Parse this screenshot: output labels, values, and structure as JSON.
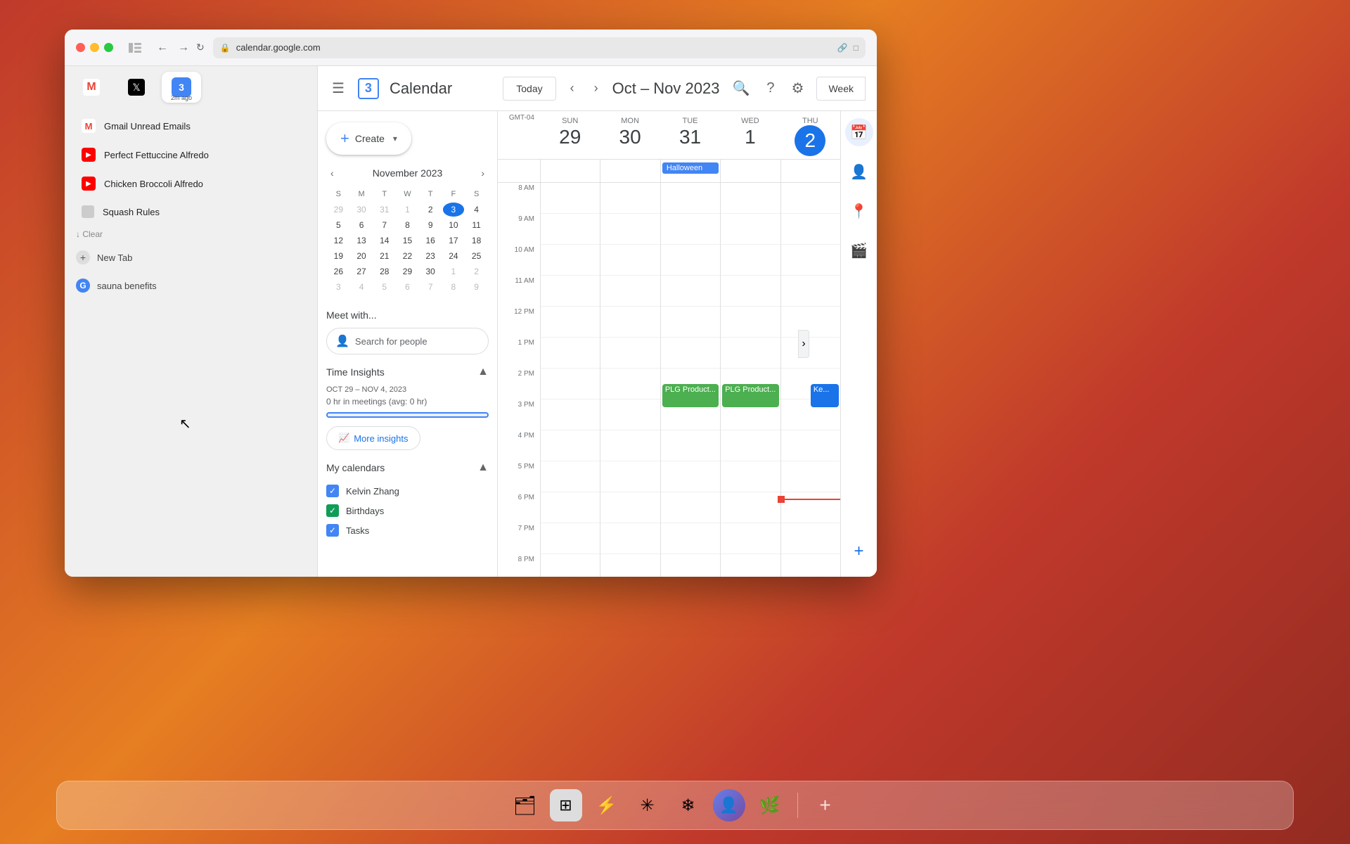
{
  "window": {
    "title": "Google Calendar",
    "url": "calendar.google.com"
  },
  "titlebar": {
    "back_label": "←",
    "forward_label": "→",
    "reload_label": "↻",
    "url": "calendar.google.com"
  },
  "tabs": [
    {
      "id": "gmail",
      "icon": "M",
      "color": "#EA4335",
      "bg": "#fff",
      "label": "Gmail"
    },
    {
      "id": "twitter",
      "icon": "𝕏",
      "color": "#000",
      "bg": "#fff",
      "label": "X"
    },
    {
      "id": "calendar",
      "icon": "3",
      "color": "#4285f4",
      "bg": "#fff",
      "label": "Google Calendar",
      "badge": "2m ago",
      "active": true
    }
  ],
  "recent_tabs": [
    {
      "id": "gmail-unread",
      "icon": "M",
      "icon_color": "#EA4335",
      "label": "Gmail Unread Emails",
      "sublabel": ""
    },
    {
      "id": "perfect-fettuccine",
      "icon": "▶",
      "icon_color": "#FF0000",
      "label": "Perfect Fettuccine Alfredo",
      "sublabel": ""
    },
    {
      "id": "chicken-broccoli",
      "icon": "▶",
      "icon_color": "#FF0000",
      "label": "Chicken Broccoli Alfredo",
      "sublabel": ""
    },
    {
      "id": "squash-rules",
      "icon": "□",
      "icon_color": "#888",
      "label": "Squash Rules",
      "sublabel": ""
    }
  ],
  "sidebar_actions": {
    "clear_label": "↓ Clear",
    "new_tab_label": "New Tab",
    "search_label": "sauna benefits"
  },
  "calendar": {
    "title": "Calendar",
    "header": {
      "today_label": "Today",
      "date_range": "Oct – Nov 2023",
      "view_label": "Week",
      "menu_icon": "☰",
      "search_icon": "🔍",
      "help_icon": "?",
      "settings_icon": "⚙"
    },
    "mini_cal": {
      "title": "November 2023",
      "days_of_week": [
        "S",
        "M",
        "T",
        "W",
        "T",
        "F",
        "S"
      ],
      "weeks": [
        [
          "29",
          "30",
          "31",
          "1",
          "2",
          "3",
          "4"
        ],
        [
          "5",
          "6",
          "7",
          "8",
          "9",
          "10",
          "11"
        ],
        [
          "12",
          "13",
          "14",
          "15",
          "16",
          "17",
          "18"
        ],
        [
          "19",
          "20",
          "21",
          "22",
          "23",
          "24",
          "25"
        ],
        [
          "26",
          "27",
          "28",
          "29",
          "30",
          "1",
          "2"
        ],
        [
          "3",
          "4",
          "5",
          "6",
          "7",
          "8",
          "9"
        ]
      ],
      "today_date": "3",
      "today_week_idx": 0,
      "today_day_idx": 5
    },
    "meet": {
      "title": "Meet with...",
      "search_placeholder": "Search for people",
      "search_icon": "👤"
    },
    "time_insights": {
      "title": "Time Insights",
      "collapse_icon": "▲",
      "date_range": "OCT 29 – NOV 4, 2023",
      "summary": "0 hr in meetings (avg: 0 hr)",
      "more_label": "More insights",
      "chart_icon": "📈"
    },
    "my_calendars": {
      "title": "My calendars",
      "collapse_icon": "▲",
      "items": [
        {
          "label": "Kelvin Zhang",
          "color": "#4285f4",
          "checked": true
        },
        {
          "label": "Birthdays",
          "color": "#0f9d58",
          "checked": true
        },
        {
          "label": "Tasks",
          "color": "#4285f4",
          "checked": true
        }
      ]
    },
    "week": {
      "gmt_label": "GMT-04",
      "days": [
        {
          "name": "SUN",
          "num": "29",
          "today": false
        },
        {
          "name": "MON",
          "num": "30",
          "today": false
        },
        {
          "name": "TUE",
          "num": "31",
          "today": false
        },
        {
          "name": "WED",
          "num": "1",
          "today": false
        },
        {
          "name": "THU",
          "num": "2",
          "today": false
        }
      ],
      "times": [
        "8 AM",
        "9 AM",
        "10 AM",
        "11 AM",
        "12 PM",
        "1 PM",
        "2 PM",
        "3 PM",
        "4 PM",
        "5 PM",
        "6 PM",
        "7 PM",
        "8 PM"
      ],
      "events": [
        {
          "day": 1,
          "label": "Halloween",
          "all_day": true,
          "color": "#1a73e8"
        },
        {
          "day": 1,
          "label": "PLG Product...",
          "start_hour": 14.5,
          "duration": 0.75,
          "color": "#4caf50",
          "text_color": "#fff"
        },
        {
          "day": 3,
          "label": "PLG Product...",
          "start_hour": 14.5,
          "duration": 0.75,
          "color": "#4caf50",
          "text_color": "#fff"
        },
        {
          "day": 4,
          "label": "Ke...",
          "start_hour": 14.5,
          "duration": 0.75,
          "color": "#1a73e8",
          "text_color": "#fff"
        }
      ],
      "current_time_hour": 18.2
    },
    "create_label": "Create",
    "create_dropdown": "▼"
  },
  "right_icons": [
    {
      "id": "calendar-side",
      "icon": "📅",
      "active": true
    },
    {
      "id": "contacts-side",
      "icon": "👤",
      "active": false
    },
    {
      "id": "maps-side",
      "icon": "📍",
      "active": false
    },
    {
      "id": "zoom-side",
      "icon": "🎥",
      "active": false
    }
  ],
  "dock": {
    "items": [
      {
        "id": "finder",
        "icon": "🗂",
        "label": "Finder"
      },
      {
        "id": "launchpad",
        "icon": "⊞",
        "label": "Launchpad"
      },
      {
        "id": "lightning",
        "icon": "⚡",
        "label": "Lightning"
      },
      {
        "id": "asterisk",
        "icon": "✳",
        "label": "Asterisk"
      },
      {
        "id": "snowflake",
        "icon": "❄",
        "label": "Snowflake"
      },
      {
        "id": "user",
        "icon": "🔵",
        "label": "User"
      },
      {
        "id": "leaf",
        "icon": "🌿",
        "label": "Leaf"
      },
      {
        "id": "add",
        "icon": "+",
        "label": "Add"
      }
    ]
  }
}
